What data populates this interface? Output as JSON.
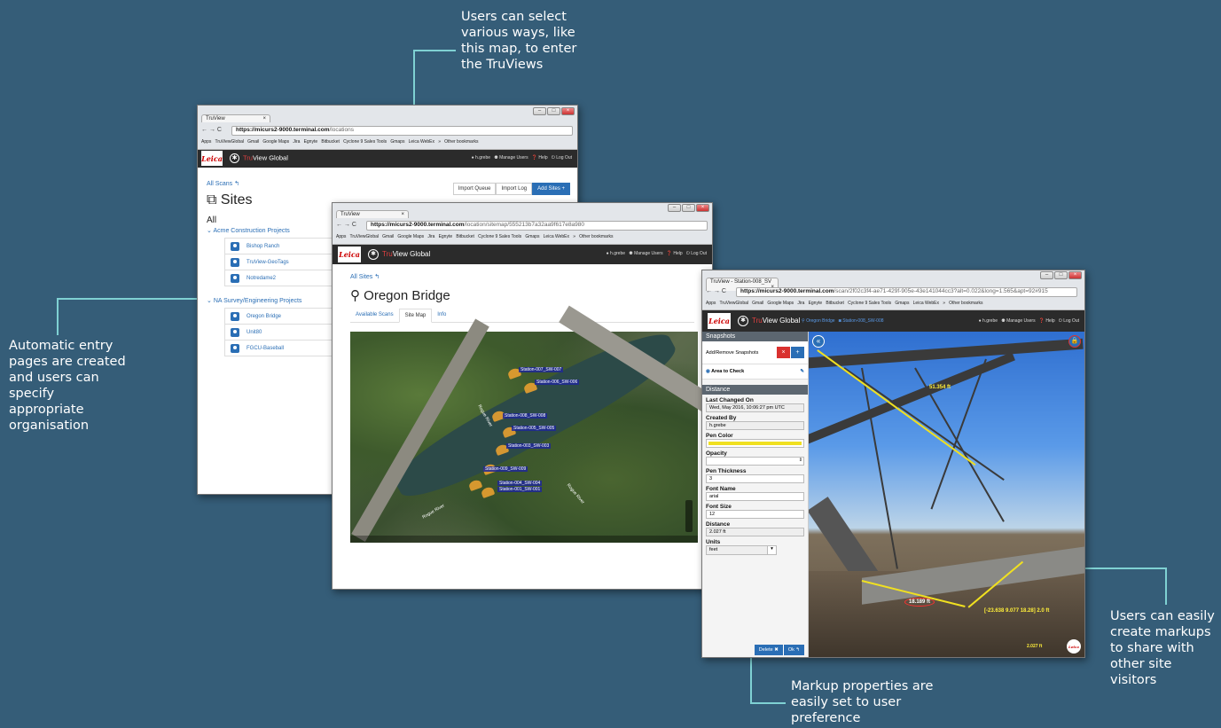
{
  "callouts": {
    "top": "Users can select various ways, like this map, to enter the TruViews",
    "left": "Automatic entry pages are created and users can specify appropriate organisation",
    "right": "Users can easily create markups to share with other site visitors",
    "bottom": "Markup properties are easily set to user preference"
  },
  "colors": {
    "background": "#355d78",
    "callout_line": "#7fd1d3",
    "accent": "#2a6eb5",
    "leica_red": "#cc0000",
    "appbar": "#2b2b2b"
  },
  "bookmarks": [
    "Apps",
    "TruViewGlobal",
    "Gmail",
    "Google Maps",
    "Jira",
    "Egnyte",
    "Bitbucket",
    "Cyclone 9 Sales Tools",
    "Gmaps",
    "Leica WebEx",
    "»",
    "Other bookmarks"
  ],
  "app": {
    "brand_tru": "Tru",
    "brand_rest": "View Global",
    "leica": "Leica",
    "user": "h.grebe",
    "manage_users": "Manage Users",
    "help": "Help",
    "logout": "Log Out"
  },
  "win1": {
    "tab": "TruView",
    "url_host": "https://micurs2-9000.terminal.com",
    "url_path": "/locations",
    "all_scans": "All Scans",
    "title": "Sites",
    "buttons": [
      "Import Queue",
      "Import Log",
      "Add Sites +"
    ],
    "all_label": "All",
    "groups": [
      {
        "name": "Acme Construction Projects",
        "sites": [
          "Bishop Ranch",
          "TruView-GeoTags",
          "Notredame2"
        ]
      },
      {
        "name": "NA Survey/Engineering Projects",
        "sites": [
          "Oregon Bridge",
          "Unit80",
          "FGCU-Baseball"
        ]
      }
    ]
  },
  "win2": {
    "tab": "TruView",
    "url_host": "https://micurs2-9000.terminal.com",
    "url_path": "/location/sitemap/555213b7a32aa9f617e8a980",
    "all_sites": "All Sites",
    "title": "Oregon Bridge",
    "tabs": [
      "Available Scans",
      "Site Map",
      "Info"
    ],
    "stations": [
      "Station-007_SW-007",
      "Station-006_SW-006",
      "Station-008_SW-008",
      "Station-005_SW-005",
      "Station-003_SW-003",
      "Station-009_SW-009",
      "Station-004_SW-004",
      "Station-001_SW-001"
    ],
    "map_labels": [
      "Rogue River",
      "Rogue River",
      "Rogue River"
    ]
  },
  "win3": {
    "tab": "TruView - Station-008_SV",
    "url_host": "https://micurs2-9000.terminal.com",
    "url_path": "/scan/2f02c3f4-ae71-429f-905e-43e141044cc3?alt=0.022&long=1.565&apt=92#915",
    "crumb_site": "Oregon Bridge",
    "crumb_station": "Station-008_SW-008",
    "snapshots_header": "Snapshots",
    "add_remove": "Add/Remove Snapshots",
    "area": "Area to Check",
    "distance_header": "Distance",
    "fields": {
      "last_changed_label": "Last Changed On",
      "last_changed": "Wed, May 2016, 10:06:27 pm UTC",
      "created_by_label": "Created By",
      "created_by": "h.grebe",
      "pen_color_label": "Pen Color",
      "pen_color": "#f0e020",
      "opacity_label": "Opacity",
      "pen_thickness_label": "Pen Thickness",
      "pen_thickness": "3",
      "font_name_label": "Font Name",
      "font_name": "arial",
      "font_size_label": "Font Size",
      "font_size": "12",
      "distance_label": "Distance",
      "distance": "2.027 ft",
      "units_label": "Units",
      "units": "feet"
    },
    "delete": "Delete",
    "ok": "Ok",
    "measures": [
      "51.354 ft",
      "18.189 ft",
      "[-23.638 9.077 18.28] 2.0 ft",
      "2.027 ft"
    ]
  }
}
